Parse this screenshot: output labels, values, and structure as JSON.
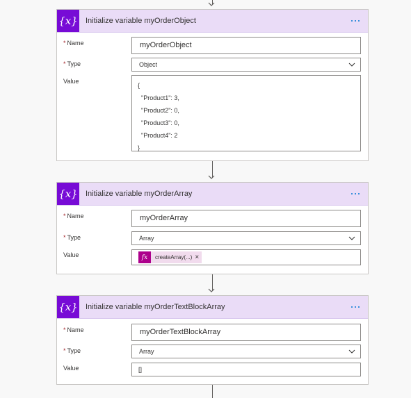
{
  "colors": {
    "header_bg": "#eadcf7",
    "icon_bg": "#770bd6",
    "accent_dots": "#0078d4",
    "required": "#a4262c",
    "expression_token": "#ad008c"
  },
  "cards": [
    {
      "title": "Initialize variable myOrderObject",
      "name_label": "Name",
      "name_value": "myOrderObject",
      "type_label": "Type",
      "type_value": "Object",
      "value_label": "Value",
      "value_lines": [
        "{",
        "  \"Product1\": 3,",
        "  \"Product2\": 0,",
        "  \"Product3\": 0,",
        "  \"Product4\": 2",
        "}"
      ]
    },
    {
      "title": "Initialize variable myOrderArray",
      "name_label": "Name",
      "name_value": "myOrderArray",
      "type_label": "Type",
      "type_value": "Array",
      "value_label": "Value",
      "value_token": "createArray(...)",
      "token_icon": "fx",
      "token_close": "×"
    },
    {
      "title": "Initialize variable myOrderTextBlockArray",
      "name_label": "Name",
      "name_value": "myOrderTextBlockArray",
      "type_label": "Type",
      "type_value": "Array",
      "value_label": "Value",
      "value_text": "[]"
    }
  ],
  "required_marker": "*",
  "icon_glyph": "{x}"
}
